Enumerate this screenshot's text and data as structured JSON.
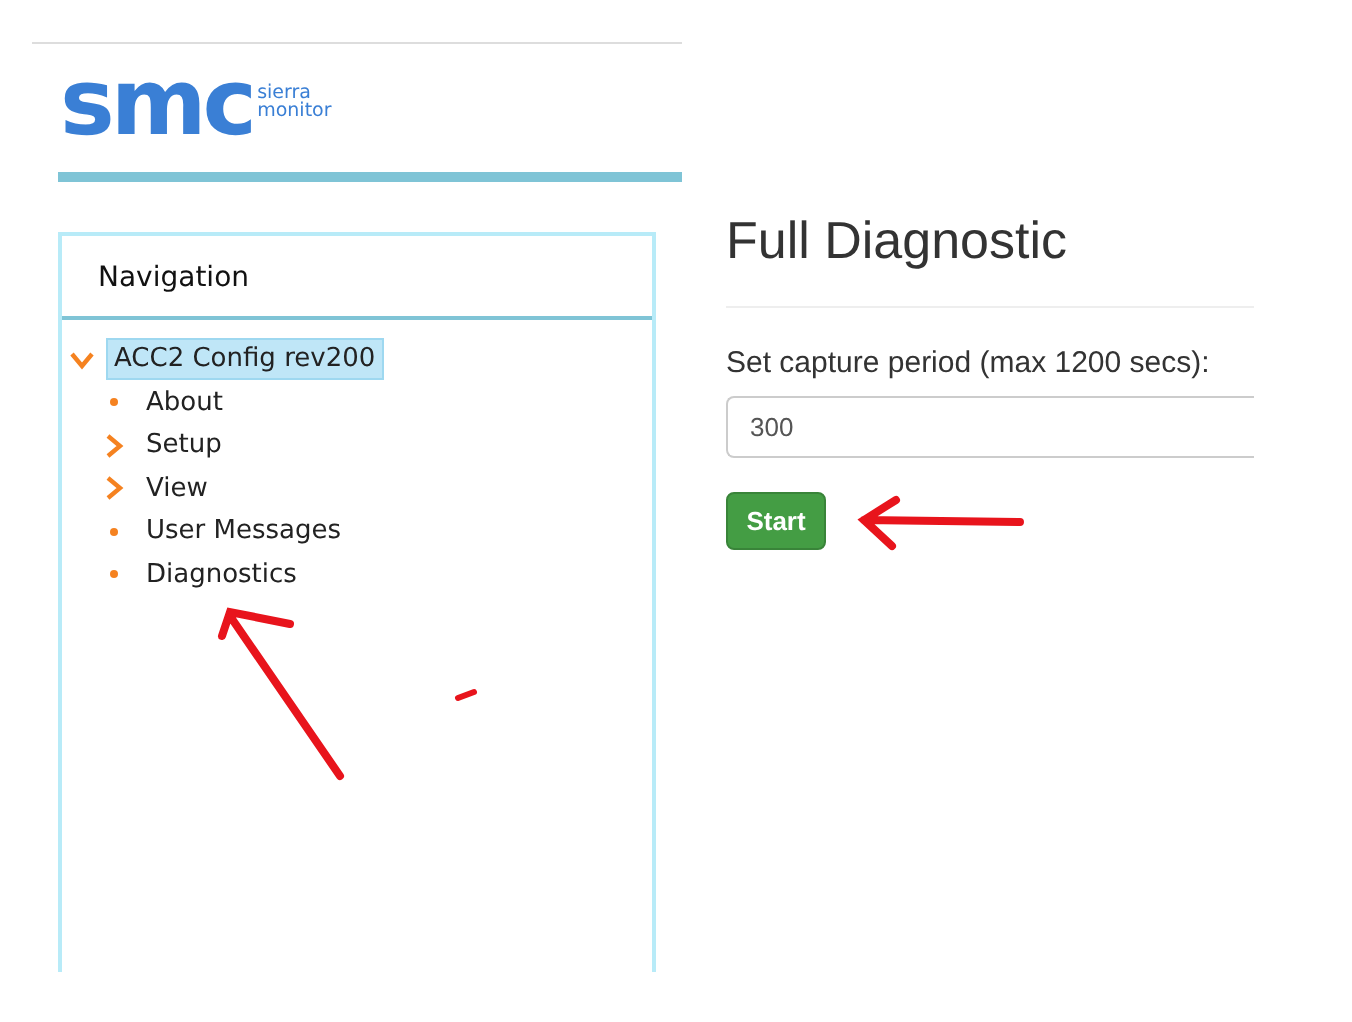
{
  "logo": {
    "mark": "smc",
    "line_1": "sierra",
    "line_2": "monitor"
  },
  "navigation": {
    "title": "Navigation",
    "tree": [
      {
        "label": "ACC2 Config rev200",
        "selected": true,
        "expanded": true,
        "children": [
          {
            "label": "About",
            "selected": false
          },
          {
            "label": "Setup",
            "selected": false,
            "expanded": false
          },
          {
            "label": "View",
            "selected": false,
            "expanded": false
          },
          {
            "label": "User Messages",
            "selected": false
          },
          {
            "label": "Diagnostics",
            "selected": false
          }
        ]
      }
    ]
  },
  "main": {
    "title": "Full Diagnostic",
    "field_label": "Set capture period (max 1200 secs):",
    "field_value": "300",
    "button": "Start"
  }
}
